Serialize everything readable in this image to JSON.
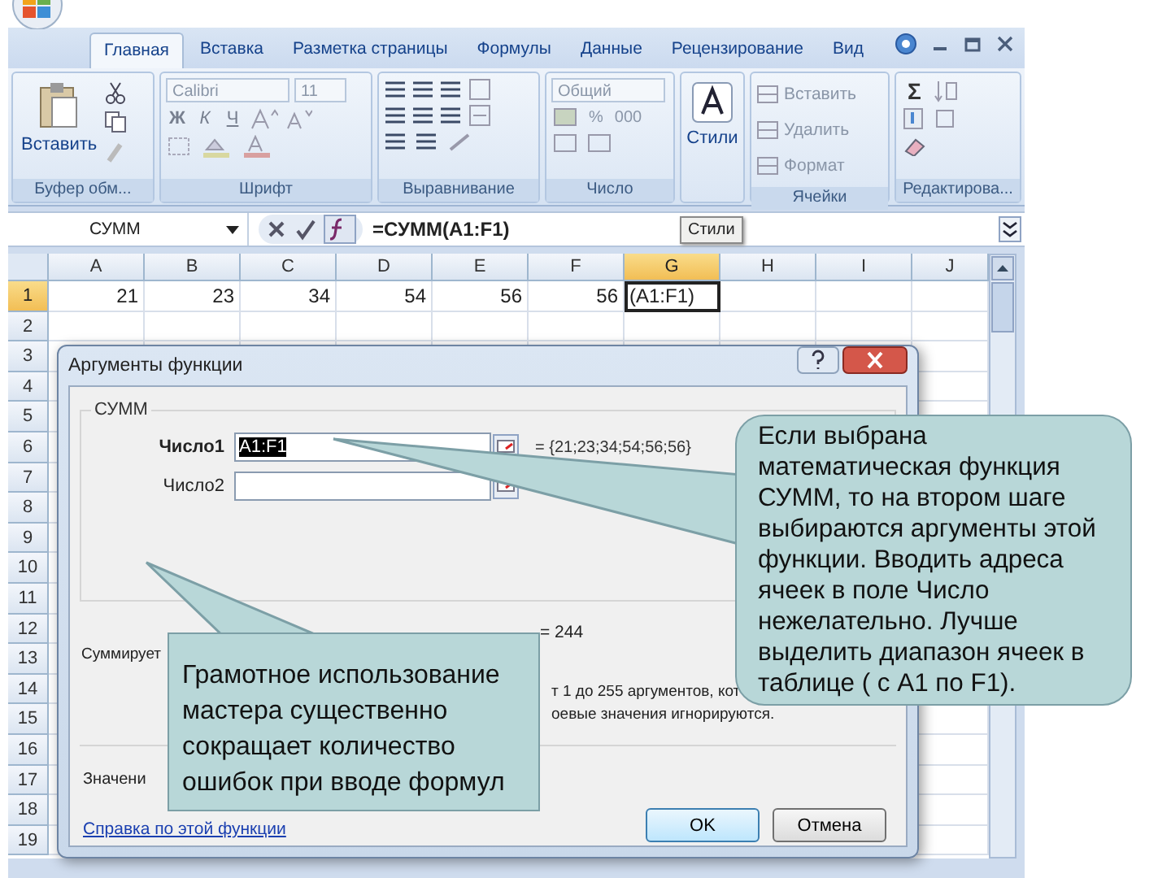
{
  "ribbon_tabs": [
    {
      "label": "Главная",
      "selected": true
    },
    {
      "label": "Вставка",
      "selected": false
    },
    {
      "label": "Разметка страницы",
      "selected": false
    },
    {
      "label": "Формулы",
      "selected": false
    },
    {
      "label": "Данные",
      "selected": false
    },
    {
      "label": "Рецензирование",
      "selected": false
    },
    {
      "label": "Вид",
      "selected": false
    }
  ],
  "ribbon_groups": [
    {
      "kind": "clipboard",
      "label": "Буфер обм...",
      "button": "Вставить"
    },
    {
      "kind": "font",
      "label": "Шрифт",
      "font_name": "Calibri",
      "font_size": "11",
      "format_buttons": [
        "Ж",
        "К",
        "Ч"
      ]
    },
    {
      "kind": "alignment",
      "label": "Выравнивание"
    },
    {
      "kind": "number",
      "label": "Число",
      "format": "Общий",
      "symbols": [
        "%",
        "000"
      ]
    },
    {
      "kind": "styles",
      "button": "Стили"
    },
    {
      "kind": "cells",
      "label": "Ячейки",
      "items": [
        "Вставить",
        "Удалить",
        "Формат"
      ]
    },
    {
      "kind": "editing",
      "label": "Редактирова...",
      "sum": "Σ"
    }
  ],
  "formula_bar": {
    "name_box": "СУММ",
    "formula": "=СУММ(A1:F1)"
  },
  "tooltip": {
    "text": "Стили"
  },
  "sheet": {
    "columns": [
      {
        "label": "A",
        "selected": false
      },
      {
        "label": "B",
        "selected": false
      },
      {
        "label": "C",
        "selected": false
      },
      {
        "label": "D",
        "selected": false
      },
      {
        "label": "E",
        "selected": false
      },
      {
        "label": "F",
        "selected": false
      },
      {
        "label": "G",
        "selected": true
      },
      {
        "label": "H",
        "selected": false
      },
      {
        "label": "I",
        "selected": false
      },
      {
        "label": "J",
        "selected": false
      }
    ],
    "rows": [
      {
        "label": "1",
        "selected": true,
        "cells": [
          {
            "value": "21",
            "kind": "number",
            "selected": false
          },
          {
            "value": "23",
            "kind": "number",
            "selected": false
          },
          {
            "value": "34",
            "kind": "number",
            "selected": false
          },
          {
            "value": "54",
            "kind": "number",
            "selected": false
          },
          {
            "value": "56",
            "kind": "number",
            "selected": false
          },
          {
            "value": "56",
            "kind": "number",
            "selected": false
          },
          {
            "value": "(A1:F1)",
            "kind": "text",
            "selected": true
          }
        ]
      },
      {
        "label": "2",
        "selected": false
      },
      {
        "label": "3",
        "selected": false
      },
      {
        "label": "4",
        "selected": false
      },
      {
        "label": "5",
        "selected": false
      },
      {
        "label": "6",
        "selected": false
      },
      {
        "label": "7",
        "selected": false
      },
      {
        "label": "8",
        "selected": false
      },
      {
        "label": "9",
        "selected": false
      },
      {
        "label": "10",
        "selected": false
      },
      {
        "label": "11",
        "selected": false
      },
      {
        "label": "12",
        "selected": false
      },
      {
        "label": "13",
        "selected": false
      },
      {
        "label": "14",
        "selected": false
      },
      {
        "label": "15",
        "selected": false
      },
      {
        "label": "16",
        "selected": false
      },
      {
        "label": "17",
        "selected": false
      },
      {
        "label": "18",
        "selected": false
      },
      {
        "label": "19",
        "selected": false
      }
    ]
  },
  "dialog": {
    "title": "Аргументы функции",
    "function": "СУММ",
    "arguments": [
      {
        "label": "Число1",
        "value": "A1:F1",
        "result": "=  {21;23;34;54;56;56}",
        "selected": true
      },
      {
        "label": "Число2",
        "selected": false
      }
    ],
    "total": "=  244",
    "description": [
      {
        "text": "Суммирует",
        "kind": "left"
      },
      {
        "text": "т 1 до 255 аргументов, кот",
        "kind": "right"
      },
      {
        "text": "оевые значения игнорируются.",
        "kind": "right"
      }
    ],
    "value_label": "Значени",
    "help_link": "Справка по этой функции",
    "buttons": [
      {
        "label": "OK",
        "kind": "default"
      },
      {
        "label": "Отмена",
        "kind": "normal"
      }
    ]
  },
  "callouts": [
    {
      "kind": "rounded",
      "text": "Если выбрана математическая функция СУММ, то на втором шаге выбираются аргументы этой функции. Вводить адреса ячеек  в поле  Число нежелательно. Лучше выделить диапазон ячеек в таблице ( с А1 по F1)."
    },
    {
      "kind": "rect",
      "text": "Грамотное использование мастера существенно сокращает количество ошибок при вводе формул"
    }
  ]
}
